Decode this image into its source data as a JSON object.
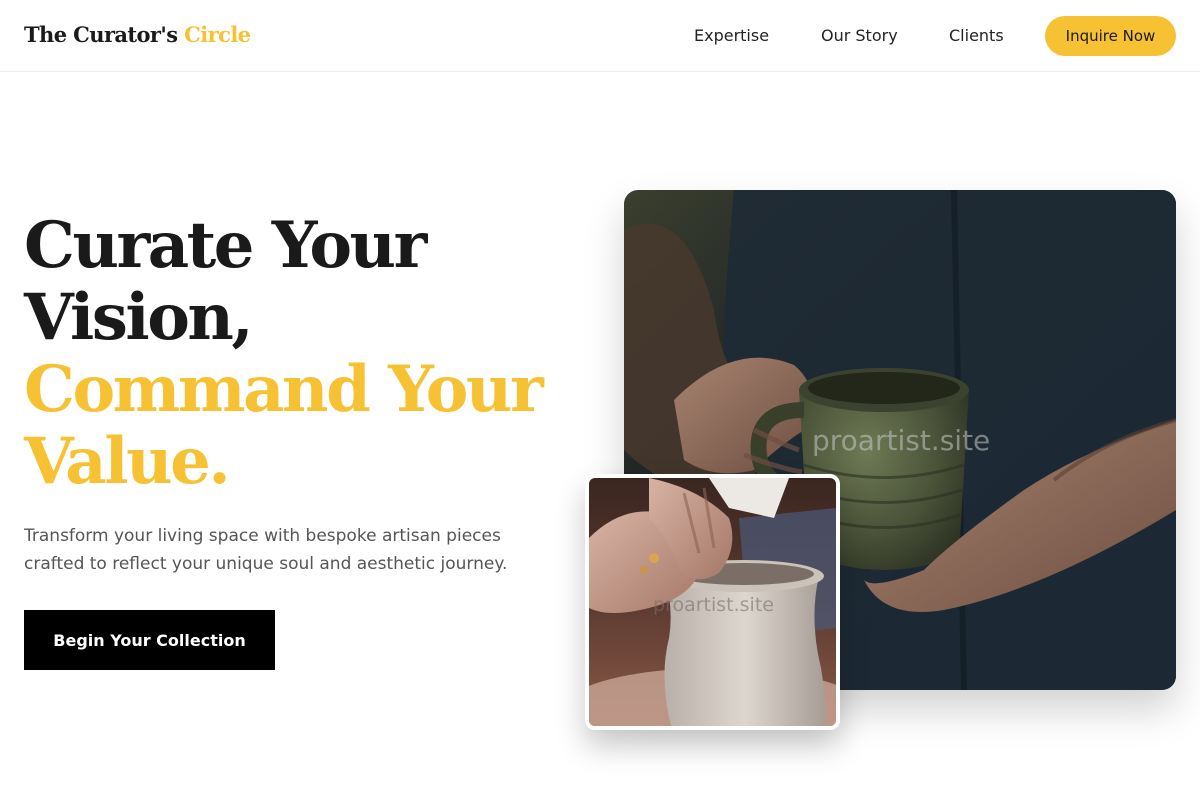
{
  "header": {
    "logo_main": "The Curator's",
    "logo_accent": "Circle",
    "nav": {
      "expertise": "Expertise",
      "story": "Our Story",
      "clients": "Clients"
    },
    "cta_label": "Inquire Now"
  },
  "hero": {
    "title_line1": "Curate Your",
    "title_line2": "Vision,",
    "title_line3": "Command Your",
    "title_line4": "Value.",
    "subtitle": "Transform your living space with bespoke artisan pieces crafted to reflect your unique soul and aesthetic journey.",
    "cta_label": "Begin Your Collection"
  },
  "images": {
    "main_watermark": "proartist.site",
    "small_watermark": "proartist.site"
  },
  "colors": {
    "accent": "#f6c133",
    "dark": "#1a1a1a",
    "cta_bg": "#000000"
  }
}
